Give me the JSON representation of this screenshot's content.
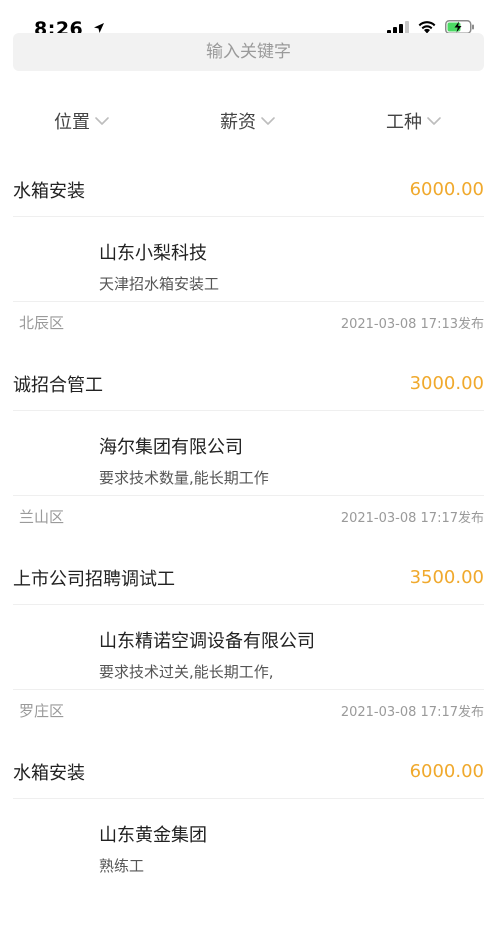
{
  "status": {
    "time": "8:26"
  },
  "search": {
    "placeholder": "输入关键字"
  },
  "filters": [
    {
      "label": "位置"
    },
    {
      "label": "薪资"
    },
    {
      "label": "工种"
    }
  ],
  "jobs": [
    {
      "title": "水箱安装",
      "salary": "6000.00",
      "company": "山东小梨科技",
      "desc": "天津招水箱安装工",
      "district": "北辰区",
      "posted": "2021-03-08 17:13发布"
    },
    {
      "title": "诚招合管工",
      "salary": "3000.00",
      "company": "海尔集团有限公司",
      "desc": "要求技术数量,能长期工作",
      "district": "兰山区",
      "posted": "2021-03-08 17:17发布"
    },
    {
      "title": "上市公司招聘调试工",
      "salary": "3500.00",
      "company": "山东精诺空调设备有限公司",
      "desc": "要求技术过关,能长期工作,",
      "district": "罗庄区",
      "posted": "2021-03-08 17:17发布"
    },
    {
      "title": "水箱安装",
      "salary": "6000.00",
      "company": "山东黄金集团",
      "desc": "熟练工",
      "district": "",
      "posted": ""
    }
  ],
  "colors": {
    "salary": "#f0a92d",
    "battery_charging": "#4cd964"
  }
}
